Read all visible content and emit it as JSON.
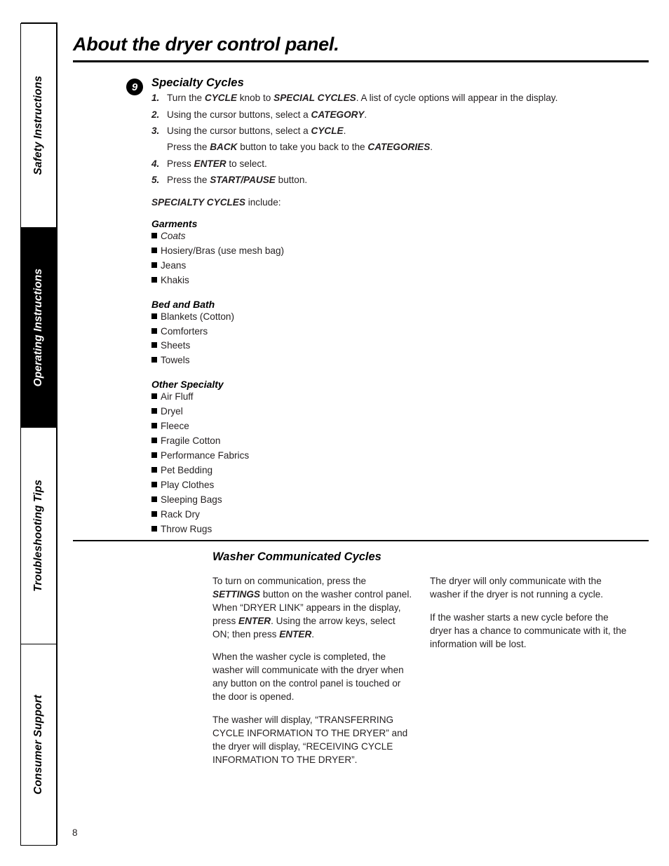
{
  "sidebar": {
    "tabs": [
      {
        "label": "Safety Instructions",
        "active": false
      },
      {
        "label": "Operating Instructions",
        "active": true
      },
      {
        "label": "Troubleshooting Tips",
        "active": false
      },
      {
        "label": "Consumer Support",
        "active": false
      }
    ]
  },
  "header": {
    "title": "About the dryer control panel."
  },
  "step_block": {
    "marker": "9",
    "heading": "Specialty Cycles",
    "steps": [
      {
        "num": "1.",
        "html": "Turn the <b class=\"em\">CYCLE</b> knob to <b class=\"em\">SPECIAL CYCLES</b>. A list of cycle options will appear in the display."
      },
      {
        "num": "2.",
        "html": "Using the cursor buttons, select a <b class=\"em\">CATEGORY</b>."
      },
      {
        "num": "3.",
        "html": "Using the cursor buttons, select a <b class=\"em\">CYCLE</b>."
      },
      {
        "num": "",
        "html": "Press the <b class=\"em\">BACK</b> button to take you back to the <b class=\"em\">CATEGORIES</b>."
      },
      {
        "num": "4.",
        "html": "Press <b class=\"em\">ENTER</b> to select."
      },
      {
        "num": "5.",
        "html": "Press the <b class=\"em\">START/PAUSE</b> button."
      }
    ],
    "include_line_html": "<b class=\"em\">SPECIALTY CYCLES</b> include:",
    "groups": [
      {
        "heading": "Garments",
        "items": [
          {
            "label": "Coats",
            "italic": true
          },
          {
            "label": "Hosiery/Bras (use mesh bag)",
            "italic": false
          },
          {
            "label": "Jeans",
            "italic": false
          },
          {
            "label": "Khakis",
            "italic": false
          }
        ]
      },
      {
        "heading": "Bed and Bath",
        "items": [
          {
            "label": "Blankets (Cotton)",
            "italic": false
          },
          {
            "label": "Comforters",
            "italic": false
          },
          {
            "label": "Sheets",
            "italic": false
          },
          {
            "label": "Towels",
            "italic": false
          }
        ]
      },
      {
        "heading": "Other Specialty",
        "items": [
          {
            "label": "Air Fluff",
            "italic": false
          },
          {
            "label": "Dryel",
            "italic": false
          },
          {
            "label": "Fleece",
            "italic": false
          },
          {
            "label": "Fragile Cotton",
            "italic": false
          },
          {
            "label": "Performance Fabrics",
            "italic": false
          },
          {
            "label": "Pet Bedding",
            "italic": false
          },
          {
            "label": "Play Clothes",
            "italic": false
          },
          {
            "label": "Sleeping Bags",
            "italic": false
          },
          {
            "label": "Rack Dry",
            "italic": false
          },
          {
            "label": "Throw Rugs",
            "italic": false
          }
        ]
      }
    ]
  },
  "washer_section": {
    "heading": "Washer Communicated Cycles",
    "left_column": [
      "To turn on communication, press the <b class=\"em\">SETTINGS</b> button on the washer control panel. When “DRYER LINK” appears in the display, press <b class=\"em\">ENTER</b>. Using the arrow keys, select ON; then press <b class=\"em\">ENTER</b>.",
      "When the washer cycle is completed, the washer will communicate with the dryer when any button on the control panel is touched or the door is opened.",
      "The washer will display, “TRANSFERRING CYCLE INFORMATION TO THE DRYER” and the dryer will display, “RECEIVING CYCLE INFORMATION TO THE DRYER”."
    ],
    "right_column": [
      "The dryer will only communicate with the washer if the dryer is not running a cycle.",
      "If the washer starts a new cycle before the dryer has a chance to communicate with it, the information will be lost."
    ]
  },
  "footer": {
    "page_number": "8"
  },
  "colors": {
    "ink": "#231f20",
    "rule": "#000000",
    "active_tab_bg": "#000000",
    "active_tab_text": "#ffffff"
  }
}
